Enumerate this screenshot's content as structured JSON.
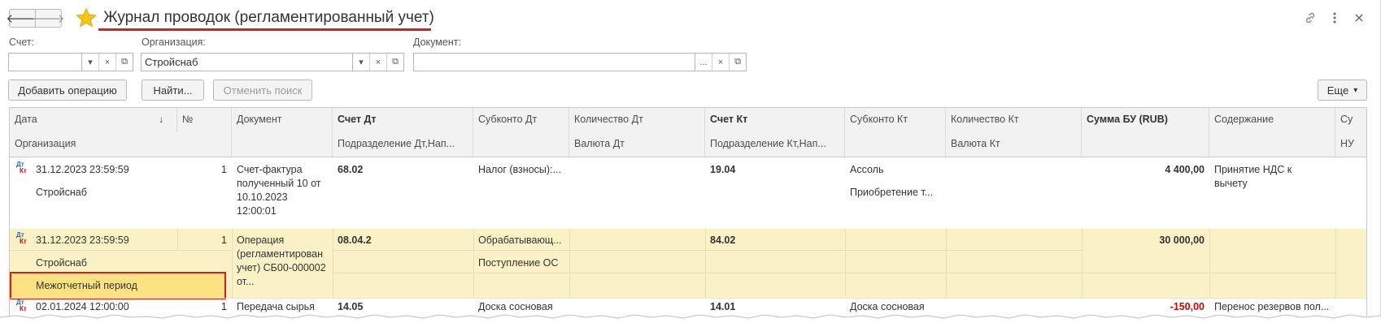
{
  "window": {
    "title": "Журнал проводок (регламентированный учет)",
    "icons": [
      "arrow-left-icon",
      "arrow-right-icon",
      "star-icon",
      "link-icon",
      "more-vertical-icon",
      "close-icon"
    ]
  },
  "filters": {
    "account": {
      "label": "Счет:",
      "value": ""
    },
    "organization": {
      "label": "Организация:",
      "value": "Стройснаб"
    },
    "document": {
      "label": "Документ:",
      "value": ""
    },
    "dropdown_glyph": "▾",
    "clear_glyph": "×",
    "open_glyph": "⧉",
    "select_glyph": "..."
  },
  "toolbar": {
    "add_operation": "Добавить операцию",
    "find": "Найти...",
    "cancel_search": "Отменить поиск",
    "more": "Еще",
    "more_arrow": "▾"
  },
  "table": {
    "headers": {
      "date": "Дата",
      "sort_arrow": "↓",
      "number": "№",
      "organization": "Организация",
      "document": "Документ",
      "account_dt": "Счет Дт",
      "subdivision_dt": "Подразделение Дт,Нап...",
      "subconto_dt": "Субконто Дт",
      "quantity_dt": "Количество Дт",
      "currency_dt": "Валюта Дт",
      "account_kt": "Счет Кт",
      "subdivision_kt": "Подразделение Кт,Нап...",
      "subconto_kt": "Субконто Кт",
      "quantity_kt": "Количество Кт",
      "currency_kt": "Валюта Кт",
      "amount": "Сумма БУ (RUB)",
      "content": "Содержание",
      "extra_top": "Су",
      "extra_bottom": "НУ"
    },
    "dtkt": {
      "dt": "Дт",
      "kt": "Кт"
    },
    "rows": [
      {
        "date": "31.12.2023 23:59:59",
        "number": "1",
        "organization": "Стройснаб",
        "document": "Счет-фактура полученный 10 от 10.10.2023 12:00:01",
        "account_dt": "68.02",
        "subconto_dt": "Налог (взносы):...",
        "account_kt": "19.04",
        "subconto_kt_1": "Ассоль",
        "subconto_kt_2": "Приобретение т...",
        "amount": "4 400,00",
        "content": "Принятие НДС к вычету"
      },
      {
        "date": "31.12.2023 23:59:59",
        "number": "1",
        "organization": "Стройснаб",
        "period_type": "Межотчетный период",
        "document": "Операция (регламентирован учет) СБ00-000002 от...",
        "account_dt": "08.04.2",
        "subconto_dt_1": "Обрабатывающ...",
        "subconto_dt_2": "Поступление ОС",
        "account_kt": "84.02",
        "amount": "30 000,00",
        "content": ""
      },
      {
        "date": "02.01.2024 12:00:00",
        "number": "1",
        "document": "Передача сырья",
        "account_dt": "14.05",
        "subconto_dt": "Доска сосновая",
        "account_kt": "14.01",
        "subconto_kt": "Доска сосновая",
        "amount": "-150,00",
        "content": "Перенос резервов пол..."
      }
    ]
  },
  "colors": {
    "selected_row": "#fbf1c6",
    "highlight_cell": "#fde283",
    "annotation_red": "#e01b1b",
    "negative_amount": "#d50000",
    "star": "#f5c518"
  }
}
